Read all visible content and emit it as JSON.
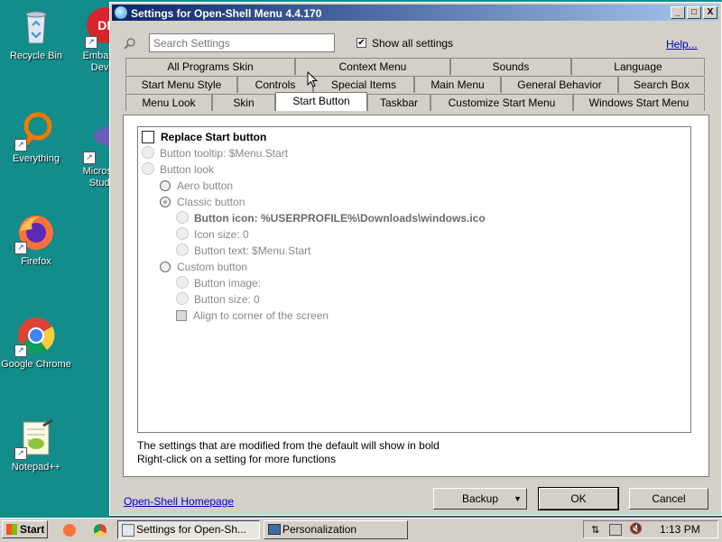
{
  "desktop": {
    "icons": [
      {
        "label": "Recycle Bin"
      },
      {
        "label": "Embar Dev-"
      },
      {
        "label": "Everything"
      },
      {
        "label": "Micros Studi"
      },
      {
        "label": "Firefox"
      },
      {
        "label": "Google Chrome"
      },
      {
        "label": "Notepad++"
      }
    ]
  },
  "window": {
    "title": "Settings for Open-Shell Menu 4.4.170",
    "minimize": "_",
    "maximize": "□",
    "close": "X"
  },
  "search": {
    "placeholder": "Search Settings",
    "value": ""
  },
  "show_all": {
    "label": "Show all settings",
    "checked": true
  },
  "help_link": "Help...",
  "tabs": {
    "row1": [
      "All Programs Skin",
      "Context Menu",
      "Sounds",
      "Language"
    ],
    "row2": [
      "Start Menu Style",
      "Controls",
      "Special Items",
      "Main Menu",
      "General Behavior",
      "Search Box"
    ],
    "row3": [
      "Menu Look",
      "Skin",
      "Start Button",
      "Taskbar",
      "Customize Start Menu",
      "Windows Start Menu"
    ],
    "active": "Start Button"
  },
  "settings": {
    "replace_start_button": "Replace Start button",
    "button_tooltip": "Button tooltip: $Menu.Start",
    "button_look": "Button look",
    "aero_button": "Aero button",
    "classic_button": "Classic button",
    "button_icon": "Button icon: %USERPROFILE%\\Downloads\\windows.ico",
    "icon_size": "Icon size: 0",
    "button_text": "Button text: $Menu.Start",
    "custom_button": "Custom button",
    "button_image": "Button image:",
    "button_size": "Button size: 0",
    "align_corner": "Align to corner of the screen"
  },
  "info": {
    "line1": "The settings that are modified from the default will show in bold",
    "line2": "Right-click on a setting for more functions"
  },
  "footer": {
    "homepage_link": "Open-Shell Homepage",
    "backup": "Backup",
    "ok": "OK",
    "cancel": "Cancel"
  },
  "taskbar": {
    "start": "Start",
    "tasks": [
      "Settings for Open-Sh...",
      "Personalization"
    ],
    "clock": "1:13 PM"
  }
}
